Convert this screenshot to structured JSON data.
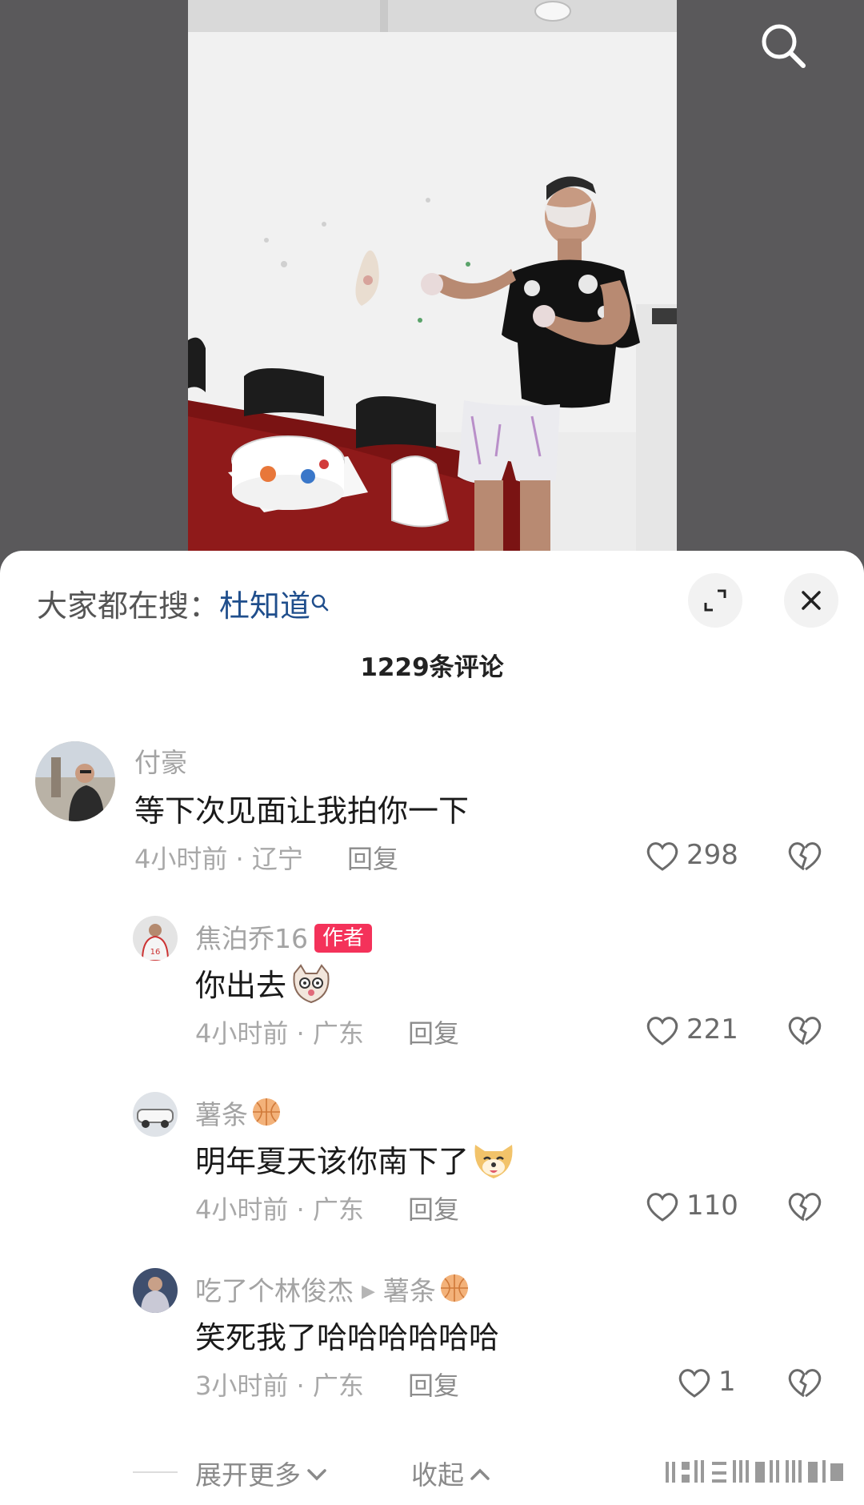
{
  "header": {
    "search_icon": "search-icon"
  },
  "sheet": {
    "hot_search_prefix": "大家都在搜：",
    "hot_search_keyword": "杜知道",
    "comment_count": "1229条评论",
    "expand_icon": "expand-icon",
    "close_icon": "close-icon"
  },
  "comments": [
    {
      "author": "付豪",
      "text": "等下次见面让我拍你一下",
      "time": "4小时前",
      "location": "辽宁",
      "reply_label": "回复",
      "likes": "298"
    },
    {
      "author": "焦泊乔16",
      "author_tag": "作者",
      "text": "你出去",
      "emoji": "cat-face-emoji",
      "time": "4小时前",
      "location": "广东",
      "reply_label": "回复",
      "likes": "221"
    },
    {
      "author": "薯条",
      "author_badge": "basketball-icon",
      "text": "明年夏天该你南下了",
      "emoji": "dog-face-emoji",
      "time": "4小时前",
      "location": "广东",
      "reply_label": "回复",
      "likes": "110"
    },
    {
      "author": "吃了个林俊杰",
      "reply_to": "薯条",
      "text": "笑死我了哈哈哈哈哈哈",
      "time": "3小时前",
      "location": "广东",
      "reply_label": "回复",
      "likes": "1"
    }
  ],
  "footer": {
    "expand_more": "展开更多",
    "collapse": "收起"
  },
  "colors": {
    "author_tag": "#f4325a",
    "keyword": "#1f4e8c",
    "sheet_bg": "#ffffff"
  }
}
